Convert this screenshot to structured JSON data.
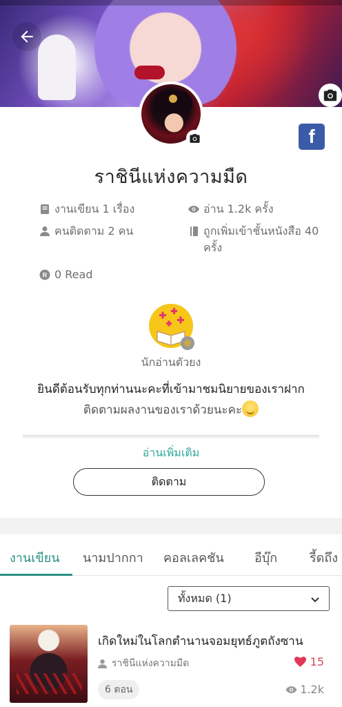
{
  "profile": {
    "name": "ราชินีแห่งความมืด",
    "stats": {
      "works": "งานเขียน 1 เรื่อง",
      "reads": "อ่าน 1.2k ครั้ง",
      "followers": "คนติดตาม 2 คน",
      "shelf_line1": "ถูกเพิ่มเข้าชั้นหนังสือ 40",
      "shelf_line2": "ครั้ง",
      "read_count": "0 Read"
    },
    "badge_label": "นักอ่านตัวยง",
    "bio_line1": "ยินดีต้อนรับทุกท่านนะคะที่เข้ามาชมนิยายของเราฝาก",
    "bio_line2": "ติดตามผลงานของเราด้วยนะคะ",
    "read_more": "อ่านเพิ่มเติม",
    "follow_button": "ติดตาม",
    "facebook_icon_text": "f"
  },
  "tabs": [
    {
      "label": "งานเขียน",
      "active": true
    },
    {
      "label": "นามปากกา",
      "active": false
    },
    {
      "label": "คอลเลคชัน",
      "active": false
    },
    {
      "label": "อีบุ๊ก",
      "active": false
    },
    {
      "label": "รี้ดถึง",
      "active": false
    }
  ],
  "filter": {
    "selected": "ทั้งหมด (1)"
  },
  "novels": [
    {
      "title": "เกิดใหม่ในโลกตำนานจอมยุทธ์ภูตถังซาน",
      "author": "ราชินีแห่งความมืด",
      "likes": "15",
      "episodes": "6 ตอน",
      "views": "1.2k"
    }
  ],
  "colors": {
    "accent": "#2a8f86",
    "link": "#2ea89a",
    "like": "#d0495e",
    "facebook": "#3b5aa8"
  }
}
